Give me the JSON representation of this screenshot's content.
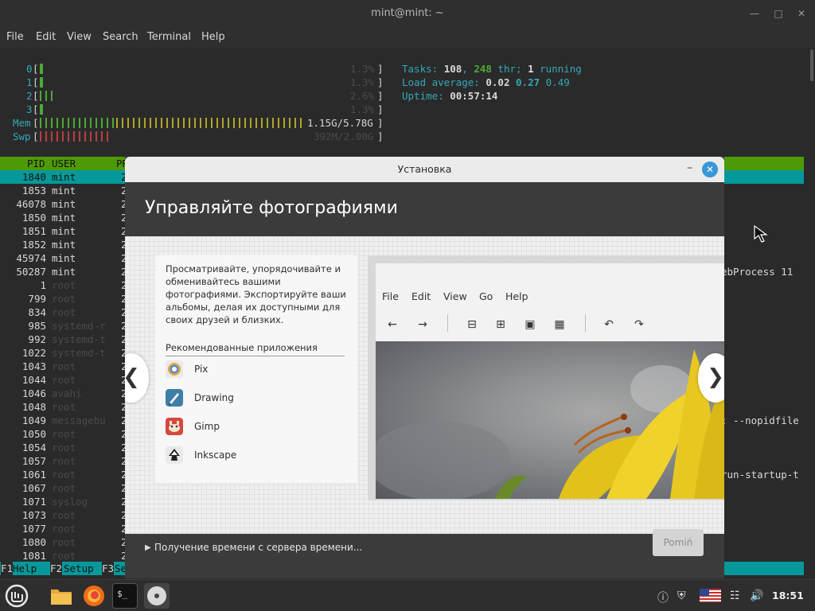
{
  "terminal": {
    "title": "mint@mint: ~",
    "menu": [
      "File",
      "Edit",
      "View",
      "Search",
      "Terminal",
      "Help"
    ],
    "cpus": [
      {
        "label": "0",
        "value": "1.3%"
      },
      {
        "label": "1",
        "value": "1.3%"
      },
      {
        "label": "2",
        "value": "2.6%"
      },
      {
        "label": "3",
        "value": "1.3%"
      }
    ],
    "mem": {
      "label": "Mem",
      "value": "1.15G/5.78G"
    },
    "swp": {
      "label": "Swp",
      "value": "392M/2.00G"
    },
    "tasks": {
      "label": "Tasks:",
      "count": "108",
      "thr": "248",
      "thr_label": "thr;",
      "running": "1",
      "running_label": "running"
    },
    "load": {
      "label": "Load average:",
      "v1": "0.02",
      "v2": "0.27",
      "v3": "0.49"
    },
    "uptime": {
      "label": "Uptime:",
      "value": "00:57:14"
    },
    "header": {
      "pid": "PID",
      "user": "USER",
      "pr": "PR"
    },
    "processes": [
      {
        "pid": "1840",
        "user": "mint"
      },
      {
        "pid": "1853",
        "user": "mint"
      },
      {
        "pid": "46078",
        "user": "mint"
      },
      {
        "pid": "1850",
        "user": "mint"
      },
      {
        "pid": "1851",
        "user": "mint"
      },
      {
        "pid": "1852",
        "user": "mint"
      },
      {
        "pid": "45974",
        "user": "mint"
      },
      {
        "pid": "50287",
        "user": "mint"
      },
      {
        "pid": "1",
        "user": "root"
      },
      {
        "pid": "799",
        "user": "root"
      },
      {
        "pid": "834",
        "user": "root"
      },
      {
        "pid": "985",
        "user": "systemd-r"
      },
      {
        "pid": "992",
        "user": "systemd-t"
      },
      {
        "pid": "1022",
        "user": "systemd-t"
      },
      {
        "pid": "1043",
        "user": "root"
      },
      {
        "pid": "1044",
        "user": "root"
      },
      {
        "pid": "1046",
        "user": "avahi"
      },
      {
        "pid": "1048",
        "user": "root"
      },
      {
        "pid": "1049",
        "user": "messagebu"
      },
      {
        "pid": "1050",
        "user": "root"
      },
      {
        "pid": "1054",
        "user": "root"
      },
      {
        "pid": "1057",
        "user": "root"
      },
      {
        "pid": "1061",
        "user": "root"
      },
      {
        "pid": "1067",
        "user": "root"
      },
      {
        "pid": "1071",
        "user": "syslog"
      },
      {
        "pid": "1073",
        "user": "root"
      },
      {
        "pid": "1077",
        "user": "root"
      },
      {
        "pid": "1080",
        "user": "root"
      },
      {
        "pid": "1081",
        "user": "root"
      }
    ],
    "pr_prefix": "2",
    "right_fragments": {
      "webprocess": "ebProcess 11",
      "nopid": ": --nopidfile",
      "startup": "run-startup-t"
    },
    "fkeys": [
      {
        "num": "F1",
        "label": "Help"
      },
      {
        "num": "F2",
        "label": "Setup"
      },
      {
        "num": "F3",
        "label": "Se"
      }
    ]
  },
  "dialog": {
    "title": "Установка",
    "heading": "Управляйте фотографиями",
    "description": "Просматривайте, упорядочивайте и обменивайтесь вашими фотографиями. Экспортируйте ваши альбомы, делая их доступными для своих друзей и близких.",
    "apps_heading": "Рекомендованные приложения",
    "apps": [
      {
        "name": "Pix",
        "icon": "pix-icon"
      },
      {
        "name": "Drawing",
        "icon": "drawing-icon"
      },
      {
        "name": "Gimp",
        "icon": "gimp-icon"
      },
      {
        "name": "Inkscape",
        "icon": "inkscape-icon"
      }
    ],
    "screenshot_menu": [
      "File",
      "Edit",
      "View",
      "Go",
      "Help"
    ],
    "status": "Получение времени с сервера времени...",
    "skip_label": "Pomiń",
    "nav_prev": "❮",
    "nav_next": "❯"
  },
  "taskbar": {
    "clock": "18:51",
    "items": [
      "menu-icon",
      "files-icon",
      "firefox-icon",
      "terminal-icon",
      "disc-icon"
    ]
  },
  "colors": {
    "htop_header_bg": "#4e9a06",
    "htop_selected_bg": "#06989a",
    "dialog_close": "#3897d9",
    "terminal_bg": "#2a2a2a"
  }
}
